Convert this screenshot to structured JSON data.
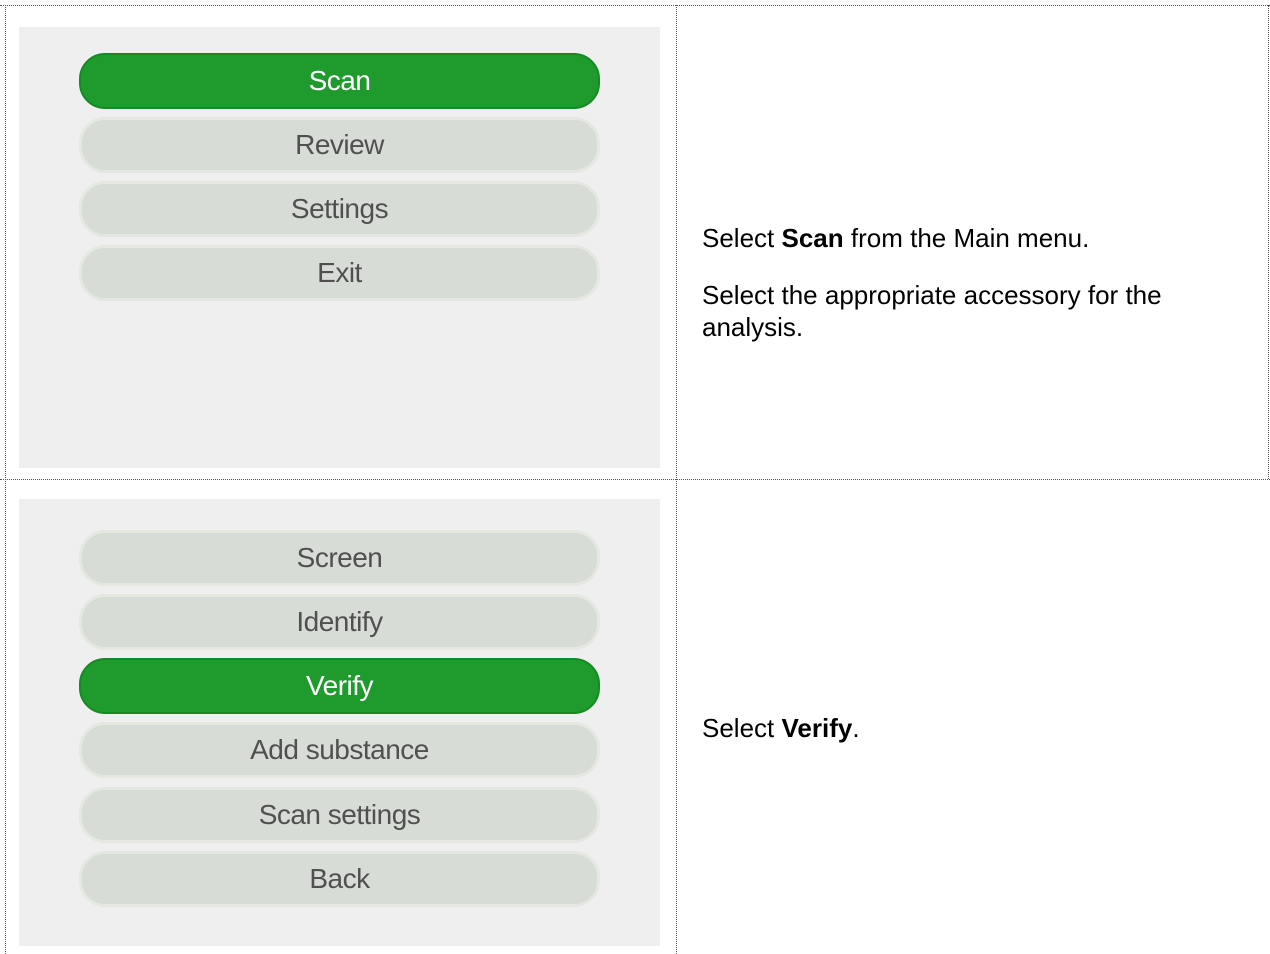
{
  "row1": {
    "menu": [
      {
        "label": "Scan",
        "selected": true
      },
      {
        "label": "Review",
        "selected": false
      },
      {
        "label": "Settings",
        "selected": false
      },
      {
        "label": "Exit",
        "selected": false
      }
    ],
    "instructions": [
      {
        "prefix": "Select ",
        "bold": "Scan",
        "suffix": " from the Main menu."
      },
      {
        "prefix": "Select the appropriate accessory for the analysis.",
        "bold": "",
        "suffix": ""
      }
    ]
  },
  "row2": {
    "menu": [
      {
        "label": "Screen",
        "selected": false
      },
      {
        "label": "Identify",
        "selected": false
      },
      {
        "label": "Verify",
        "selected": true
      },
      {
        "label": "Add substance",
        "selected": false
      },
      {
        "label": "Scan settings",
        "selected": false
      },
      {
        "label": "Back",
        "selected": false
      }
    ],
    "instructions": [
      {
        "prefix": "Select ",
        "bold": "Verify",
        "suffix": "."
      }
    ]
  },
  "colors": {
    "selected": "#1f9a2d",
    "unselected": "#d8dcd6",
    "screen_bg": "#efefef"
  }
}
